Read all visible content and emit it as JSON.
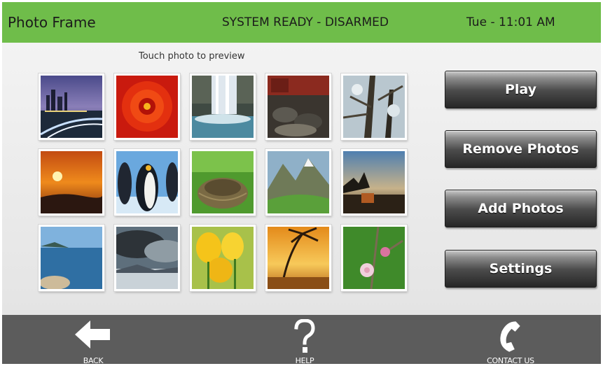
{
  "header": {
    "title": "Photo Frame",
    "status": "SYSTEM READY - DISARMED",
    "clock": "Tue - 11:01 AM",
    "color": "#6fbd4a"
  },
  "gallery": {
    "hint": "Touch photo to preview",
    "photos": [
      "city-skyline-night",
      "red-flower",
      "waterfall",
      "turtles-on-rocks",
      "tree-branches",
      "sunset",
      "penguins",
      "birds-nest",
      "mountain-valley",
      "dusk-landscape",
      "ocean-shore",
      "storm-clouds",
      "yellow-tulips",
      "tropical-sunset",
      "pink-blossom"
    ]
  },
  "actions": {
    "play": "Play",
    "remove": "Remove Photos",
    "add": "Add Photos",
    "settings": "Settings"
  },
  "footer": {
    "back": "BACK",
    "help": "HELP",
    "contact": "CONTACT US",
    "icons": [
      "back-arrow-icon",
      "help-question-icon",
      "phone-icon"
    ]
  }
}
